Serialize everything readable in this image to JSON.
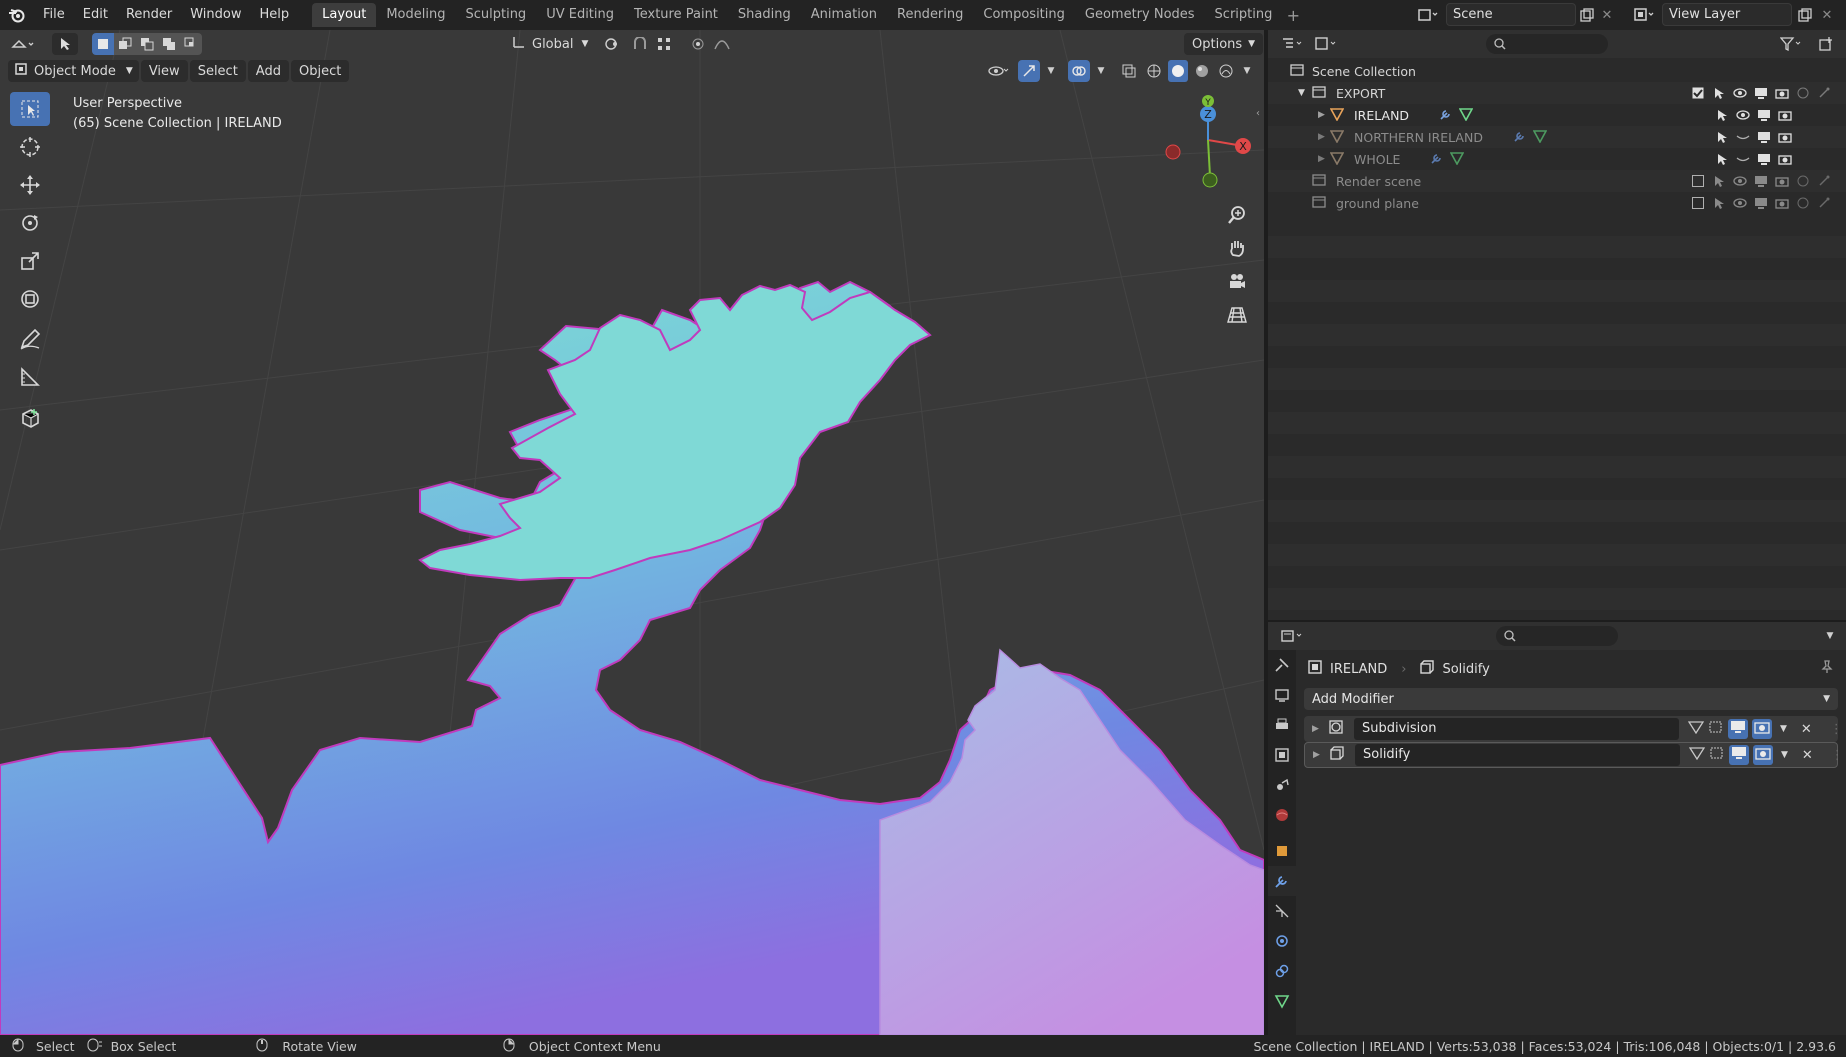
{
  "menu": {
    "items": [
      "File",
      "Edit",
      "Render",
      "Window",
      "Help"
    ]
  },
  "workspaces": [
    "Layout",
    "Modeling",
    "Sculpting",
    "UV Editing",
    "Texture Paint",
    "Shading",
    "Animation",
    "Rendering",
    "Compositing",
    "Geometry Nodes",
    "Scripting"
  ],
  "scene": {
    "name": "Scene",
    "view_layer": "View Layer"
  },
  "viewport": {
    "transform_orientation": "Global",
    "options_label": "Options",
    "mode": "Object Mode",
    "menus": [
      "View",
      "Select",
      "Add",
      "Object"
    ],
    "overlay_line1": "User Perspective",
    "overlay_line2": "(65) Scene Collection | IRELAND",
    "gizmo": {
      "x": "X",
      "y": "Y",
      "z": "Z"
    },
    "colors": {
      "background": "#393939",
      "map_top": "#6fd8d4",
      "map_bottom": "#7e74e0",
      "map_right": "#c08ee0",
      "edge": "#c33cc0"
    }
  },
  "outliner": {
    "root": "Scene Collection",
    "rows": [
      {
        "label": "EXPORT",
        "kind": "collection"
      },
      {
        "label": "IRELAND",
        "kind": "object"
      },
      {
        "label": "NORTHERN IRELAND",
        "kind": "object"
      },
      {
        "label": "WHOLE",
        "kind": "object"
      },
      {
        "label": "Render scene",
        "kind": "collection"
      },
      {
        "label": "ground plane",
        "kind": "collection"
      }
    ]
  },
  "properties": {
    "object_name": "IRELAND",
    "active_modifier": "Solidify",
    "add_modifier": "Add Modifier",
    "modifiers": [
      "Subdivision",
      "Solidify"
    ]
  },
  "statusbar": {
    "select": "Select",
    "box_select": "Box Select",
    "rotate_view": "Rotate View",
    "context_menu": "Object Context Menu",
    "stats": "Scene Collection | IRELAND | Verts:53,038 | Faces:53,024 | Tris:106,048 | Objects:0/1 | 2.93.6"
  }
}
